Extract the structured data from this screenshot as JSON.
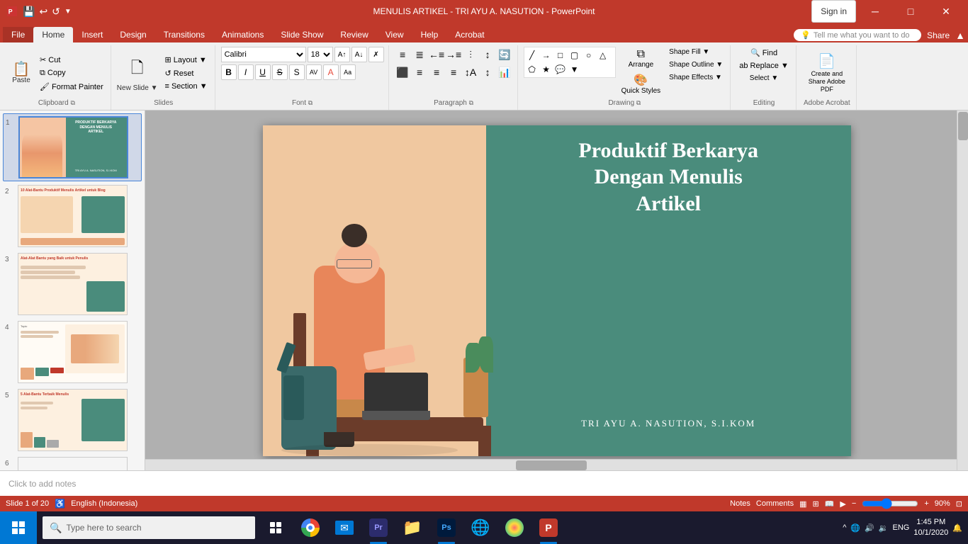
{
  "titlebar": {
    "title": "MENULIS ARTIKEL - TRI AYU A. NASUTION - PowerPoint",
    "controls": [
      "minimize",
      "maximize",
      "close"
    ],
    "save_icon": "💾",
    "undo_icon": "↩",
    "redo_icon": "↺",
    "quick_access": "▼"
  },
  "tabs": [
    {
      "label": "File",
      "id": "file"
    },
    {
      "label": "Home",
      "id": "home",
      "active": true
    },
    {
      "label": "Insert",
      "id": "insert"
    },
    {
      "label": "Design",
      "id": "design"
    },
    {
      "label": "Transitions",
      "id": "transitions"
    },
    {
      "label": "Animations",
      "id": "animations"
    },
    {
      "label": "Slide Show",
      "id": "slideshow"
    },
    {
      "label": "Review",
      "id": "review"
    },
    {
      "label": "View",
      "id": "view"
    },
    {
      "label": "Help",
      "id": "help"
    },
    {
      "label": "Acrobat",
      "id": "acrobat"
    }
  ],
  "tell_me": {
    "placeholder": "Tell me what you want to do",
    "icon": "💡"
  },
  "ribbon": {
    "groups": [
      {
        "id": "clipboard",
        "label": "Clipboard",
        "buttons": [
          {
            "id": "paste",
            "label": "Paste",
            "icon": "📋"
          },
          {
            "id": "cut",
            "label": "Cut",
            "icon": "✂"
          },
          {
            "id": "copy",
            "label": "Copy",
            "icon": "⧉"
          },
          {
            "id": "format-painter",
            "label": "",
            "icon": "🖌"
          }
        ]
      },
      {
        "id": "slides",
        "label": "Slides",
        "buttons": [
          {
            "id": "new-slide",
            "label": "New Slide",
            "icon": "🗋"
          },
          {
            "id": "layout",
            "label": "Layout ▼",
            "icon": ""
          },
          {
            "id": "reset",
            "label": "Reset",
            "icon": ""
          },
          {
            "id": "section",
            "label": "Section ▼",
            "icon": ""
          }
        ]
      },
      {
        "id": "font",
        "label": "Font",
        "font_name": "Calibri",
        "font_size": "18",
        "bold": "B",
        "italic": "I",
        "underline": "U",
        "strikethrough": "S",
        "shadow": "S"
      },
      {
        "id": "paragraph",
        "label": "Paragraph"
      },
      {
        "id": "drawing",
        "label": "Drawing",
        "shape_fill": "Shape Fill ▼",
        "shape_outline": "Shape Outline ▼",
        "shape_effects": "Shape Effects ▼",
        "arrange": "Arrange",
        "quick_styles": "Quick Styles"
      },
      {
        "id": "editing",
        "label": "Editing",
        "find": "Find",
        "replace": "Replace ▼",
        "select": "Select ▼"
      },
      {
        "id": "adobe",
        "label": "Adobe Acrobat",
        "create": "Create and Share Adobe PDF"
      }
    ]
  },
  "slide": {
    "title": "Produktif Berkarya Dengan Menulis Artikel",
    "subtitle": "TRI AYU A. NASUTION, S.I.KOM",
    "bg_color": "#4a8c7c",
    "left_bg": "#f5c5a3"
  },
  "slide_panel": {
    "slides": [
      {
        "num": 1,
        "active": true
      },
      {
        "num": 2,
        "active": false
      },
      {
        "num": 3,
        "active": false
      },
      {
        "num": 4,
        "active": false
      },
      {
        "num": 5,
        "active": false
      },
      {
        "num": 6,
        "active": false
      }
    ],
    "total": 20
  },
  "notes": {
    "placeholder": "Click to add notes",
    "label": "Notes"
  },
  "statusbar": {
    "slide_info": "Slide 1 of 20",
    "language": "English (Indonesia)",
    "zoom": "90%",
    "notes_label": "Notes",
    "comments_label": "Comments"
  },
  "taskbar": {
    "search_placeholder": "Type here to search",
    "time": "1:45 PM",
    "date": "10/1/2020",
    "language_indicator": "ENG",
    "apps": [
      {
        "id": "task-view",
        "icon": "⧉"
      },
      {
        "id": "edge",
        "icon": "🌐"
      },
      {
        "id": "chrome",
        "icon": "●"
      },
      {
        "id": "mail",
        "icon": "✉"
      },
      {
        "id": "adobe-premiere",
        "icon": "Pr"
      },
      {
        "id": "files",
        "icon": "📁"
      },
      {
        "id": "photoshop",
        "icon": "Ps"
      },
      {
        "id": "vpn",
        "icon": "🌐"
      },
      {
        "id": "paint",
        "icon": "🎨"
      },
      {
        "id": "powerpoint",
        "icon": "P"
      }
    ]
  },
  "signin": {
    "label": "Sign in"
  },
  "share": {
    "label": "Share"
  }
}
